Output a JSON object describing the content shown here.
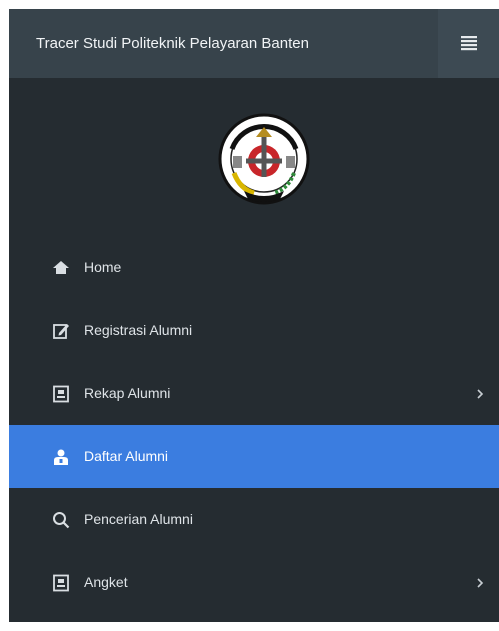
{
  "header": {
    "title": "Tracer Studi Politeknik Pelayaran Banten",
    "menu_icon": "hamburger-icon"
  },
  "logo": {
    "icon": "institution-emblem"
  },
  "sidebar": {
    "active_color": "#3b7de0",
    "items": [
      {
        "label": "Home",
        "icon": "home-icon",
        "has_submenu": false,
        "active": false
      },
      {
        "label": "Registrasi Alumni",
        "icon": "edit-icon",
        "has_submenu": false,
        "active": false
      },
      {
        "label": "Rekap Alumni",
        "icon": "report-icon",
        "has_submenu": true,
        "active": false
      },
      {
        "label": "Daftar Alumni",
        "icon": "user-list-icon",
        "has_submenu": false,
        "active": true
      },
      {
        "label": "Pencerian Alumni",
        "icon": "search-icon",
        "has_submenu": false,
        "active": false
      },
      {
        "label": "Angket",
        "icon": "report-icon",
        "has_submenu": true,
        "active": false
      }
    ]
  }
}
